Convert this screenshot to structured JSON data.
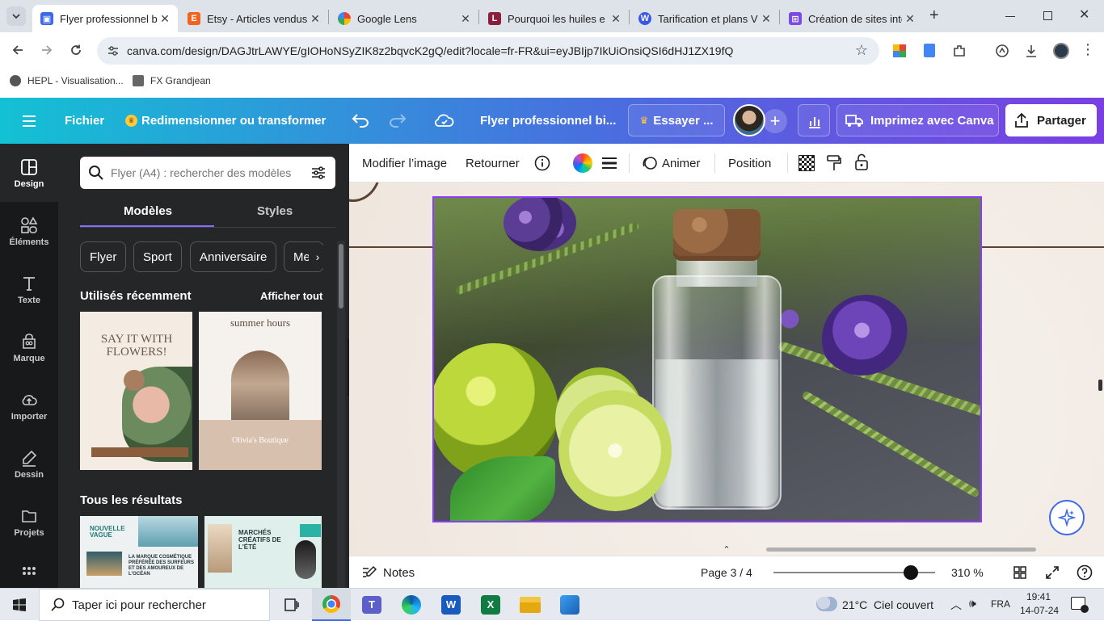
{
  "browser": {
    "tabs": [
      {
        "title": "Flyer professionnel bi",
        "favicon": "canva-icon",
        "active": true
      },
      {
        "title": "Etsy - Articles vendus",
        "favicon": "etsy-icon",
        "active": false
      },
      {
        "title": "Google Lens",
        "favicon": "google-lens-icon",
        "active": false
      },
      {
        "title": "Pourquoi les huiles e",
        "favicon": "l-icon",
        "active": false
      },
      {
        "title": "Tarification et plans V",
        "favicon": "wordpress-icon",
        "active": false
      },
      {
        "title": "Création de sites inte",
        "favicon": "site-builder-icon",
        "active": false
      }
    ],
    "url": "canva.com/design/DAGJtrLAWYE/gIOHoNSyZIK8z2bqvcK2gQ/edit?locale=fr-FR&ui=eyJBIjp7IkUiOnsiQSI6dHJ1ZX19fQ",
    "bookmarks": [
      {
        "label": "HEPL - Visualisation...",
        "icon": "hepl-icon"
      },
      {
        "label": "FX Grandjean",
        "icon": "fx-icon"
      }
    ]
  },
  "header": {
    "file": "Fichier",
    "resize": "Redimensionner ou transformer",
    "title": "Flyer professionnel bi...",
    "try": "Essayer ...",
    "print": "Imprimez avec Canva",
    "share": "Partager"
  },
  "rail": [
    {
      "label": "Design",
      "icon": "design-icon",
      "active": true
    },
    {
      "label": "Éléments",
      "icon": "elements-icon",
      "active": false
    },
    {
      "label": "Texte",
      "icon": "text-icon",
      "active": false
    },
    {
      "label": "Marque",
      "icon": "brand-icon",
      "active": false
    },
    {
      "label": "Importer",
      "icon": "upload-icon",
      "active": false
    },
    {
      "label": "Dessin",
      "icon": "draw-icon",
      "active": false
    },
    {
      "label": "Projets",
      "icon": "folder-icon",
      "active": false
    }
  ],
  "panel": {
    "search_placeholder": "Flyer (A4) : rechercher des modèles",
    "tab_models": "Modèles",
    "tab_styles": "Styles",
    "chips": [
      "Flyer",
      "Sport",
      "Anniversaire",
      "Men"
    ],
    "recent_title": "Utilisés récemment",
    "see_all": "Afficher tout",
    "all_results": "Tous les résultats",
    "templates": {
      "t1_title": "SAY IT WITH FLOWERS!",
      "t2_title": "summer hours",
      "t2_sub": "Olivia's Boutique",
      "t3_title": "NOUVELLE VAGUE",
      "t3_body": "LA MARQUE COSMÉTIQUE PRÉFÉRÉE DES SURFEURS ET DES AMOUREUX DE L'OCÉAN",
      "t4_title": "MARCHÉS CRÉATIFS DE L'ÉTÉ"
    }
  },
  "toolbar": {
    "edit_image": "Modifier l’image",
    "flip": "Retourner",
    "animate": "Animer",
    "position": "Position"
  },
  "footer": {
    "notes": "Notes",
    "page": "Page 3 / 4",
    "zoom": "310 %",
    "zoom_level": 0.85
  },
  "taskbar": {
    "search_placeholder": "Taper ici pour rechercher",
    "weather": "21°C  Ciel couvert",
    "lang": "FRA",
    "time": "19:41",
    "date": "14-07-24"
  },
  "colors": {
    "canva_cyan": "#13c1d4",
    "canva_purple": "#7a3fe3",
    "selection": "#8b3dff",
    "panel_bg": "#252627"
  }
}
